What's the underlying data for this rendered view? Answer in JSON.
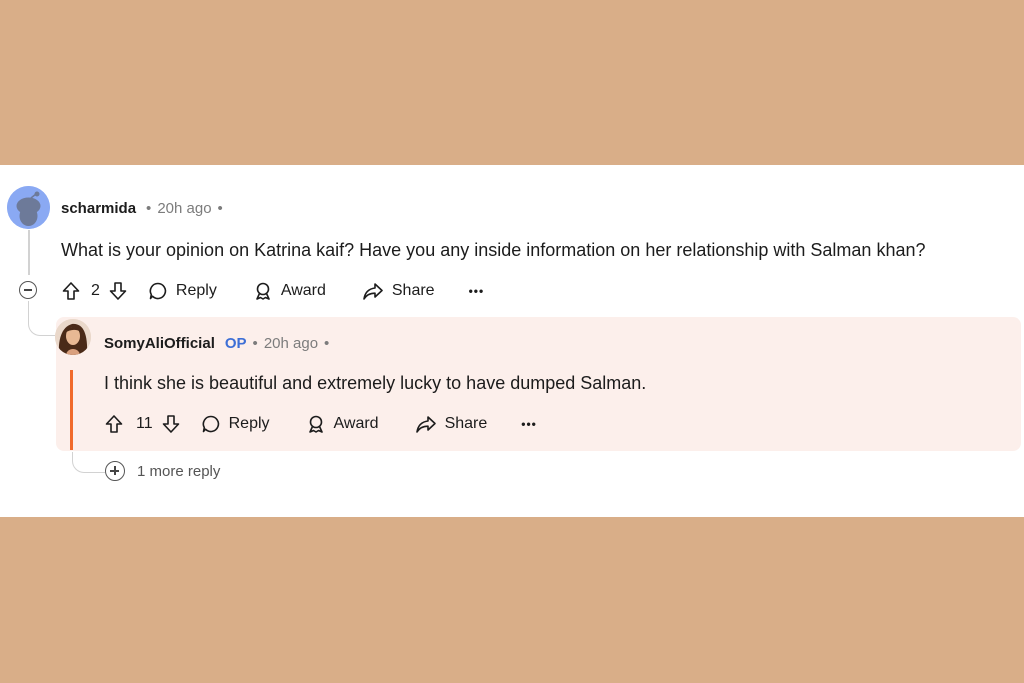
{
  "comment": {
    "username": "scharmida",
    "time": "20h ago",
    "text": "What is your opinion on Katrina kaif? Have you any inside information on her relationship with Salman khan?",
    "votes": "2",
    "actions": {
      "reply": "Reply",
      "award": "Award",
      "share": "Share",
      "more": "•••"
    }
  },
  "reply": {
    "username": "SomyAliOfficial",
    "badge": "OP",
    "time": "20h ago",
    "text": "I think she is beautiful and extremely lucky to have dumped Salman.",
    "votes": "11",
    "actions": {
      "reply": "Reply",
      "award": "Award",
      "share": "Share",
      "more": "•••"
    }
  },
  "more_replies": "1 more reply",
  "separator": "•",
  "icons": [
    "upvote-icon",
    "downvote-icon",
    "comment-icon",
    "award-icon",
    "share-icon",
    "more-icon",
    "collapse-icon",
    "expand-icon"
  ],
  "colors": {
    "background": "#d9ae88",
    "op_badge": "#3d6fd6",
    "highlight": "#fcefeb",
    "accent_bar": "#f06a2b"
  }
}
